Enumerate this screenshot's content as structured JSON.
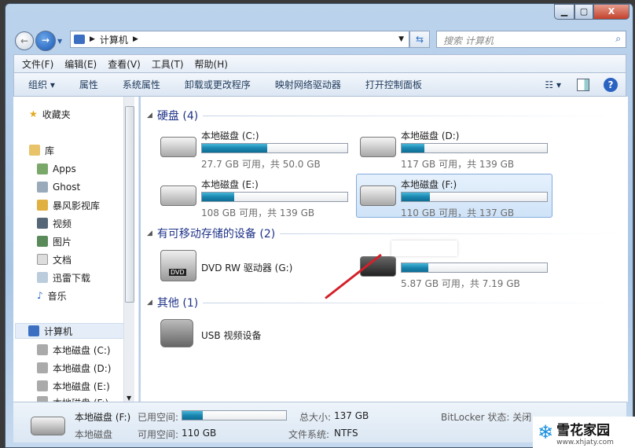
{
  "window": {
    "controls": [
      "minimize",
      "maximize",
      "close"
    ],
    "close_glyph": "X"
  },
  "address": {
    "crumbs": [
      "计算机"
    ],
    "search_placeholder": "搜索 计算机"
  },
  "menu": [
    "文件(F)",
    "编辑(E)",
    "查看(V)",
    "工具(T)",
    "帮助(H)"
  ],
  "toolbar": [
    "组织 ▾",
    "属性",
    "系统属性",
    "卸载或更改程序",
    "映射网络驱动器",
    "打开控制面板"
  ],
  "sidebar": {
    "favorites": "收藏夹",
    "libraries": "库",
    "library_items": [
      "Apps",
      "Ghost",
      "暴风影视库",
      "视频",
      "图片",
      "文档",
      "迅雷下载",
      "音乐"
    ],
    "computer": "计算机",
    "computer_items": [
      "本地磁盘 (C:)",
      "本地磁盘 (D:)",
      "本地磁盘 (E:)",
      "本地磁盘 (F:)"
    ]
  },
  "groups": [
    {
      "title": "硬盘 (4)",
      "drives": [
        {
          "name": "本地磁盘 (C:)",
          "free": "27.7 GB 可用，共 50.0 GB",
          "used_pct": 44.6
        },
        {
          "name": "本地磁盘 (D:)",
          "free": "117 GB 可用，共 139 GB",
          "used_pct": 15.8
        },
        {
          "name": "本地磁盘 (E:)",
          "free": "108 GB 可用，共 139 GB",
          "used_pct": 22.3
        },
        {
          "name": "本地磁盘 (F:)",
          "free": "110 GB 可用，共 137 GB",
          "used_pct": 19.7,
          "selected": true
        }
      ]
    },
    {
      "title": "有可移动存储的设备 (2)",
      "items": [
        {
          "name": "DVD RW 驱动器 (G:)"
        },
        {
          "name": "",
          "free": "5.87 GB 可用，共 7.19 GB",
          "used_pct": 18.4
        }
      ]
    },
    {
      "title": "其他 (1)",
      "items": [
        {
          "name": "USB 视频设备"
        }
      ]
    }
  ],
  "details": {
    "name": "本地磁盘 (F:)",
    "type": "本地磁盘",
    "used_label": "已用空间:",
    "used_pct": 19.7,
    "free_label": "可用空间:",
    "free": "110 GB",
    "total_label": "总大小:",
    "total": "137 GB",
    "fs_label": "文件系统:",
    "fs": "NTFS",
    "bitlocker": "BitLocker 状态: 关闭"
  },
  "watermark": {
    "brand": "雪花家园",
    "url": "www.xhjaty.com"
  },
  "colors": {
    "accent": "#1a86b0",
    "arrow": "#d4202a"
  }
}
